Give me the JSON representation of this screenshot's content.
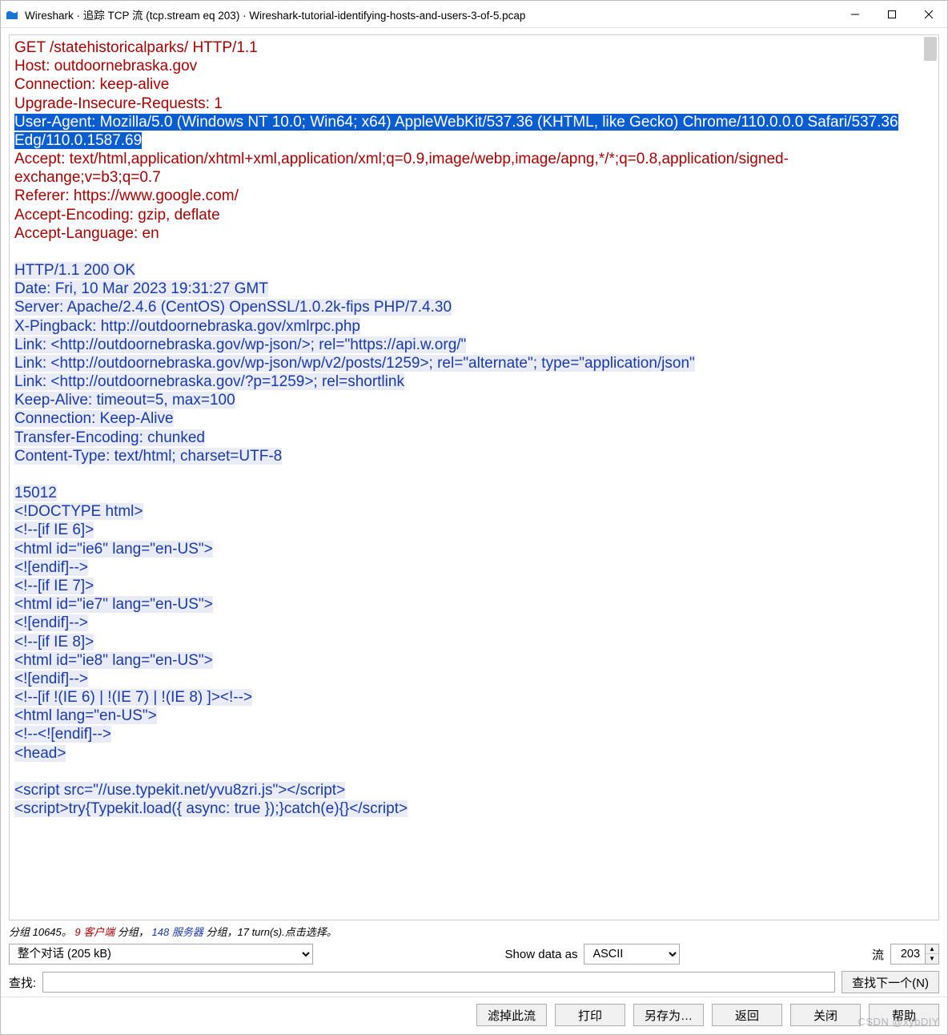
{
  "window": {
    "title": "Wireshark · 追踪 TCP 流 (tcp.stream eq 203) · Wireshark-tutorial-identifying-hosts-and-users-3-of-5.pcap"
  },
  "request": {
    "lines": [
      "GET /statehistoricalparks/ HTTP/1.1",
      "Host: outdoornebraska.gov",
      "Connection: keep-alive",
      "Upgrade-Insecure-Requests: 1"
    ],
    "selected": "User-Agent: Mozilla/5.0 (Windows NT 10.0; Win64; x64) AppleWebKit/537.36 (KHTML, like Gecko) Chrome/110.0.0.0 Safari/537.36 Edg/110.0.1587.69",
    "lines2": [
      "Accept: text/html,application/xhtml+xml,application/xml;q=0.9,image/webp,image/apng,*/*;q=0.8,application/signed-exchange;v=b3;q=0.7",
      "Referer: https://www.google.com/",
      "Accept-Encoding: gzip, deflate",
      "Accept-Language: en"
    ]
  },
  "response": {
    "headers": [
      "HTTP/1.1 200 OK",
      "Date: Fri, 10 Mar 2023 19:31:27 GMT",
      "Server: Apache/2.4.6 (CentOS) OpenSSL/1.0.2k-fips PHP/7.4.30",
      "X-Pingback: http://outdoornebraska.gov/xmlrpc.php",
      "Link: <http://outdoornebraska.gov/wp-json/>; rel=\"https://api.w.org/\"",
      "Link: <http://outdoornebraska.gov/wp-json/wp/v2/posts/1259>; rel=\"alternate\"; type=\"application/json\"",
      "Link: <http://outdoornebraska.gov/?p=1259>; rel=shortlink",
      "Keep-Alive: timeout=5, max=100",
      "Connection: Keep-Alive",
      "Transfer-Encoding: chunked",
      "Content-Type: text/html; charset=UTF-8"
    ],
    "body": [
      "15012",
      "<!DOCTYPE html>",
      "<!--[if IE 6]>",
      "<html id=\"ie6\" lang=\"en-US\">",
      "<![endif]-->",
      "<!--[if IE 7]>",
      "<html id=\"ie7\" lang=\"en-US\">",
      "<![endif]-->",
      "<!--[if IE 8]>",
      "<html id=\"ie8\" lang=\"en-US\">",
      "<![endif]-->",
      "<!--[if !(IE 6) | !(IE 7) | !(IE 8)  ]><!-->",
      "<html lang=\"en-US\">",
      "<!--<![endif]-->",
      "<head>",
      "",
      "<script src=\"//use.typekit.net/yvu8zri.js\"></script>",
      "<script>try{Typekit.load({ async: true });}catch(e){}</script>"
    ]
  },
  "status": {
    "prefix": "分组 10645。",
    "client_n": "9",
    "client_word": "客户端",
    "mid": " 分组，",
    "server_n": "148",
    "server_word": "服务器",
    "suffix": " 分组，17 turn(s).点击选择。"
  },
  "controls": {
    "conversation_label": "整个对话  (205 kB)",
    "show_as_label": "Show data as",
    "show_as_value": "ASCII",
    "stream_label": "流",
    "stream_value": "203",
    "find_label": "查找:",
    "find_next": "查找下一个(N)"
  },
  "buttons": {
    "filter_out": "滤掉此流",
    "print": "打印",
    "save_as": "另存为…",
    "back": "返回",
    "close": "关闭",
    "help": "帮助"
  },
  "watermark": "CSDN @xybDIY"
}
